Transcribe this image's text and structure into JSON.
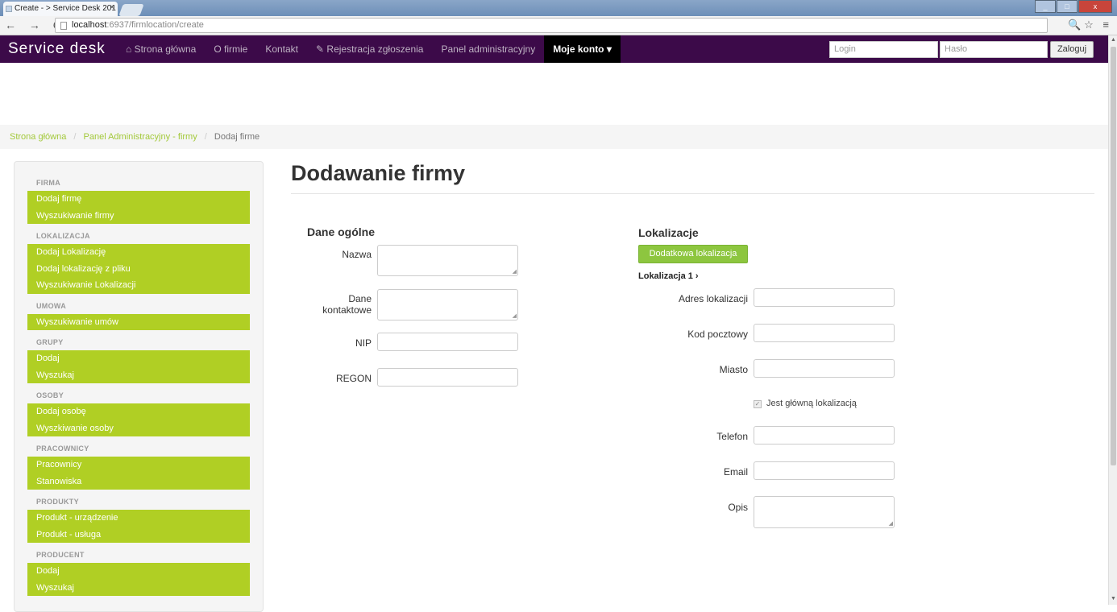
{
  "browser": {
    "tab_title": "Create - > Service Desk 201",
    "tab_close": "×",
    "url_host": "localhost",
    "url_path": ":6937/firmlocation/create",
    "nav_icons": "← → C",
    "right_icons": "🔍☆ ≡",
    "window_min": "_",
    "window_max": "□",
    "window_close": "x"
  },
  "navbar": {
    "brand": "Service desk",
    "links": [
      {
        "label": "⌂ Strona główna"
      },
      {
        "label": "O firmie"
      },
      {
        "label": "Kontakt"
      },
      {
        "label": "✎ Rejestracja zgłoszenia"
      },
      {
        "label": "Panel administracyjny"
      },
      {
        "label": "Moje konto ▾"
      }
    ],
    "login_placeholder": "Login",
    "password_placeholder": "Hasło",
    "login_button": "Zaloguj"
  },
  "breadcrumb": {
    "home": "Strona główna",
    "sep": "/",
    "panel": "Panel Administracyjny - firmy",
    "current": "Dodaj firme"
  },
  "sidebar": [
    {
      "heading": "FIRMA",
      "items": [
        "Dodaj firmę",
        "Wyszukiwanie firmy"
      ]
    },
    {
      "heading": "LOKALIZACJA",
      "items": [
        "Dodaj Lokalizację",
        "Dodaj lokalizację z pliku",
        "Wyszukiwanie Lokalizacji"
      ]
    },
    {
      "heading": "UMOWA",
      "items": [
        "Wyszukiwanie umów"
      ]
    },
    {
      "heading": "GRUPY",
      "items": [
        "Dodaj",
        "Wyszukaj"
      ]
    },
    {
      "heading": "OSOBY",
      "items": [
        "Dodaj osobę",
        "Wyszkiwanie osoby"
      ]
    },
    {
      "heading": "PRACOWNICY",
      "items": [
        "Pracownicy",
        "Stanowiska"
      ]
    },
    {
      "heading": "PRODUKTY",
      "items": [
        "Produkt - urządzenie",
        "Produkt - usługa"
      ]
    },
    {
      "heading": "PRODUCENT",
      "items": [
        "Dodaj",
        "Wyszukaj"
      ]
    }
  ],
  "main": {
    "title": "Dodawanie firmy",
    "general": {
      "heading": "Dane ogólne",
      "nazwa": "Nazwa",
      "kontakt": "Dane kontaktowe",
      "nip": "NIP",
      "regon": "REGON"
    },
    "locations": {
      "heading": "Lokalizacje",
      "add_button": "Dodatkowa lokalizacja",
      "loc_heading": "Lokalizacja 1 ›",
      "adres": "Adres lokalizacji",
      "kod": "Kod pocztowy",
      "miasto": "Miasto",
      "main_check": "Jest główną lokalizacją",
      "main_check_state": true,
      "telefon": "Telefon",
      "email": "Email",
      "opis": "Opis"
    }
  }
}
